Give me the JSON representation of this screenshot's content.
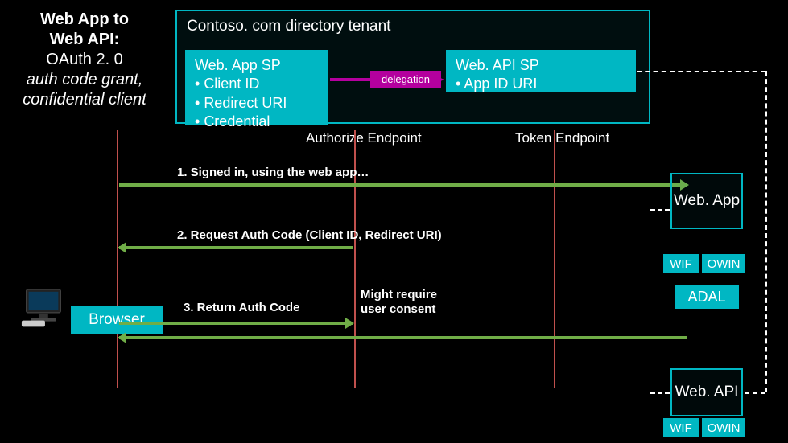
{
  "title": {
    "line1": "Web App to",
    "line2": "Web API:",
    "line3": "OAuth 2. 0",
    "line4": "auth code grant,",
    "line5": "confidential client"
  },
  "tenant": {
    "title": "Contoso. com directory tenant",
    "webapp_sp": {
      "title": "Web. App SP",
      "items": [
        "Client ID",
        "Redirect URI",
        "Credential"
      ]
    },
    "webapi_sp": {
      "title": "Web. API SP",
      "items": [
        "App ID URI"
      ]
    },
    "delegation": "delegation"
  },
  "endpoints": {
    "authorize": "Authorize Endpoint",
    "token": "Token Endpoint"
  },
  "browser": "Browser",
  "flows": {
    "step1": "1. Signed in, using the web app…",
    "step2": "2. Request Auth Code (Client ID, Redirect URI)",
    "step3": "3. Return Auth Code",
    "step3_note": "Might require\nuser consent"
  },
  "stacks": {
    "webapp": "Web. App",
    "webapi": "Web. API",
    "wif": "WIF",
    "owin": "OWIN",
    "adal": "ADAL"
  }
}
